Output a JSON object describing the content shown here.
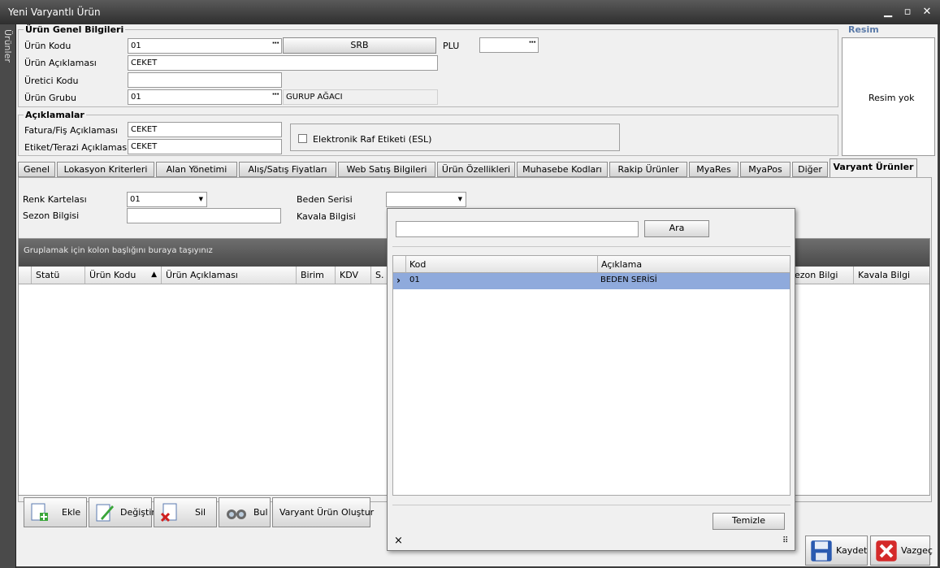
{
  "window": {
    "title": "Yeni Varyantlı Ürün",
    "minimize": "▁",
    "maximize": "▫",
    "close": "✕"
  },
  "side_tab": "Ürünler",
  "general": {
    "title": "Ürün Genel Bilgileri",
    "code_label": "Ürün Kodu",
    "code_value": "01",
    "srb_button": "SRB",
    "plu_label": "PLU",
    "plu_value": "",
    "desc_label": "Ürün Açıklaması",
    "desc_value": "CEKET",
    "maker_label": "Üretici Kodu",
    "maker_value": "",
    "group_label": "Ürün Grubu",
    "group_value": "01",
    "group_name": "GURUP AĞACI"
  },
  "image": {
    "title": "Resim",
    "placeholder": "Resim yok"
  },
  "descriptions": {
    "title": "Açıklamalar",
    "invoice_label": "Fatura/Fiş Açıklaması",
    "invoice_value": "CEKET",
    "tag_label": "Etiket/Terazi Açıklaması",
    "tag_value": "CEKET",
    "esl_label": "Elektronik Raf Etiketi (ESL)"
  },
  "tabs": [
    "Genel",
    "Lokasyon Kriterleri",
    "Alan Yönetimi",
    "Alış/Satış Fiyatları",
    "Web Satış Bilgileri",
    "Ürün Özellikleri",
    "Muhasebe Kodları",
    "Rakip Ürünler",
    "MyaRes",
    "MyaPos",
    "Diğer",
    "Varyant Ürünler"
  ],
  "variant": {
    "color_label": "Renk Kartelası",
    "color_value": "01",
    "season_label": "Sezon Bilgisi",
    "season_value": "",
    "size_label": "Beden Serisi",
    "size_value": "",
    "kavala_label": "Kavala Bilgisi"
  },
  "grid": {
    "group_hint": "Gruplamak için kolon başlığını buraya taşıyınız",
    "columns": [
      "Statü",
      "Ürün Kodu",
      "Ürün Açıklaması",
      "Birim",
      "KDV",
      "S.",
      "ezon Bilgi",
      "Kavala Bilgi"
    ],
    "sort_icon": "▲"
  },
  "bottom_buttons": {
    "add": "Ekle",
    "edit": "Değiştir",
    "delete": "Sil",
    "find": "Bul",
    "create": "Varyant Ürün Oluştur"
  },
  "popup": {
    "search_value": "",
    "search_button": "Ara",
    "col_code": "Kod",
    "col_desc": "Açıklama",
    "rows": [
      {
        "code": "01",
        "desc": "BEDEN  SERİSİ"
      }
    ],
    "row_indicator": "›",
    "clear_button": "Temizle",
    "close": "×",
    "grip": "⠿"
  },
  "footer": {
    "save": "Kaydet",
    "cancel": "Vazgeç"
  },
  "colors": {
    "titlebar": "#3c3c3c",
    "selected_row": "#8faadc",
    "panel": "#f0f0f0"
  }
}
